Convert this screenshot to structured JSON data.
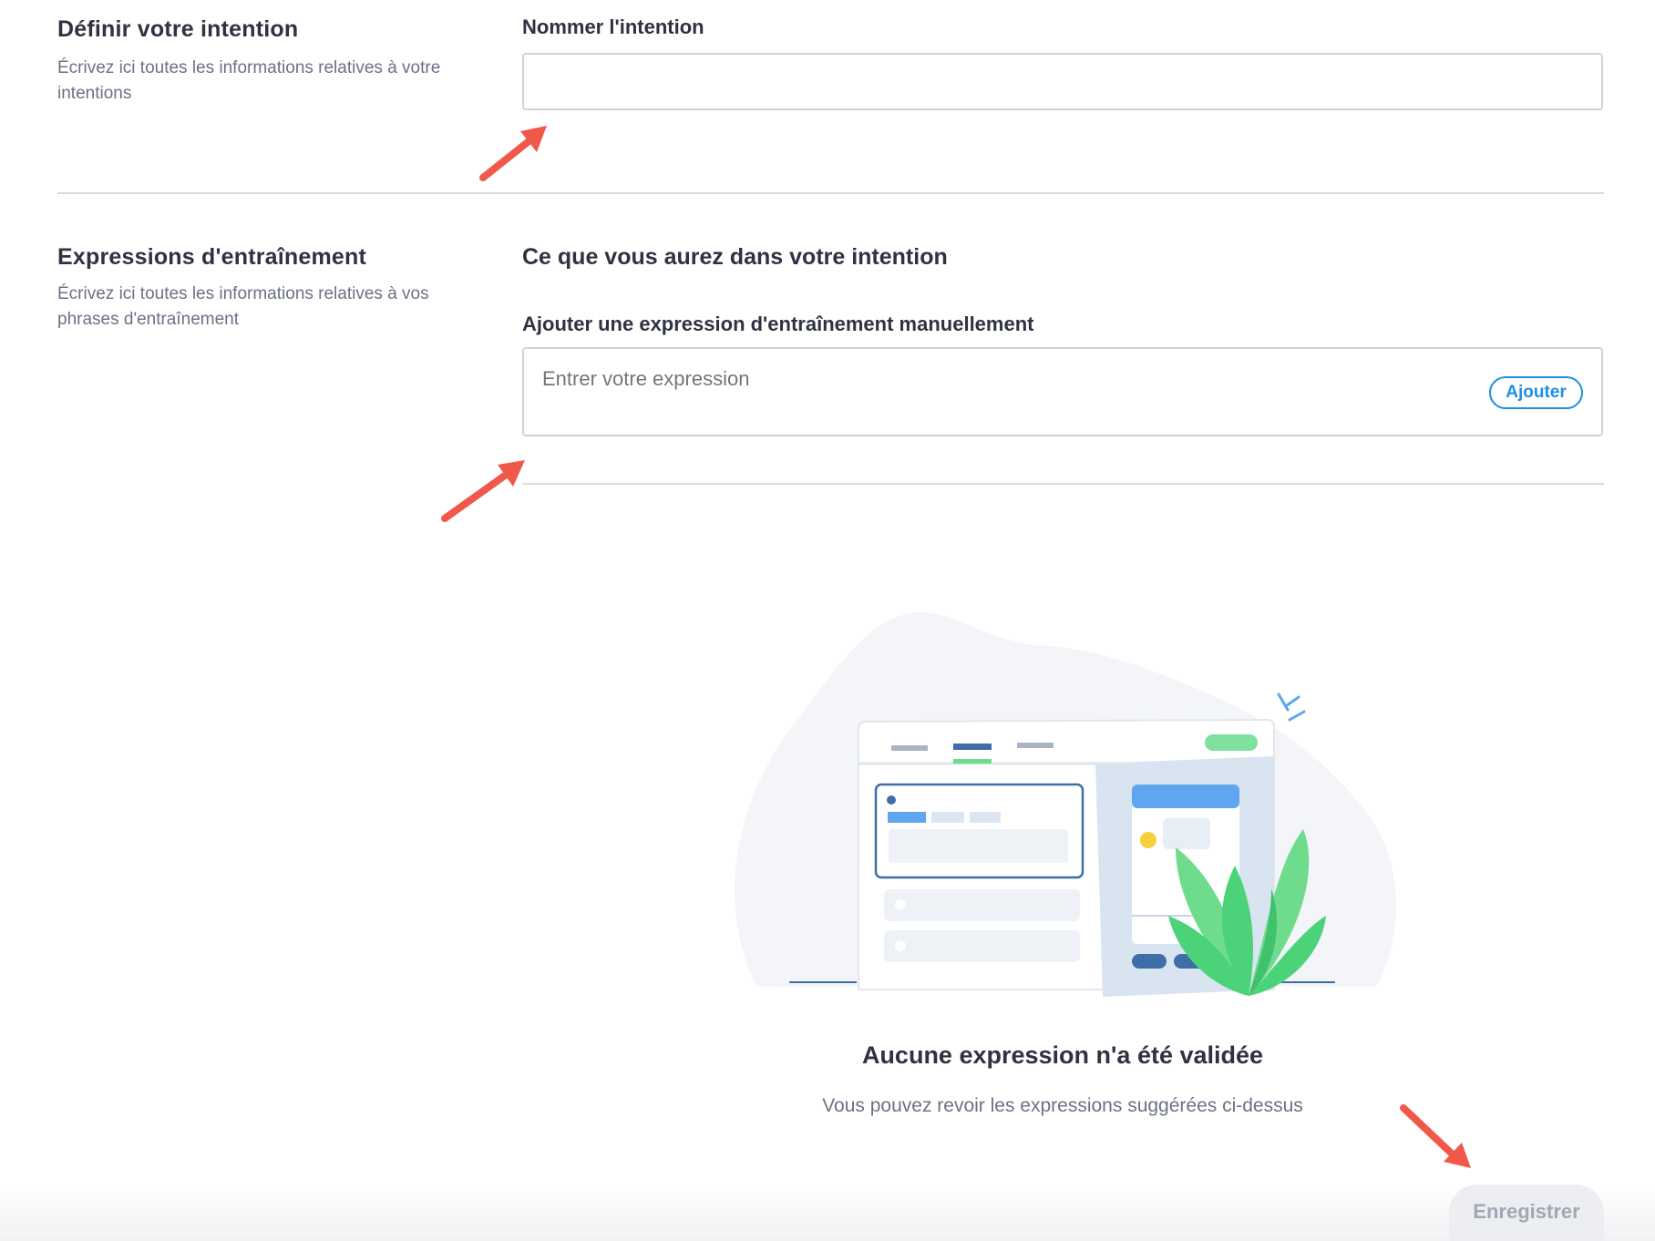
{
  "define_section": {
    "title": "Définir votre intention",
    "description": "Écrivez ici toutes les informations relatives à votre intentions",
    "name_label": "Nommer l'intention",
    "name_value": ""
  },
  "training_section": {
    "title": "Expressions d'entraînement",
    "description": "Écrivez ici toutes les informations relatives à vos phrases d'entraînement",
    "subtitle": "Ce que vous aurez dans votre intention",
    "add_label": "Ajouter une expression d'entraînement manuellement",
    "expression_placeholder": "Entrer votre expression",
    "add_button": "Ajouter"
  },
  "empty_state": {
    "title": "Aucune expression n'a été validée",
    "subtitle": "Vous pouvez revoir les expressions suggérées ci-dessus"
  },
  "footer": {
    "save_button": "Enregistrer"
  },
  "colors": {
    "accent": "#1d8fe1",
    "annotation_arrow": "#f0594a",
    "plant_green": "#4cd37a"
  }
}
